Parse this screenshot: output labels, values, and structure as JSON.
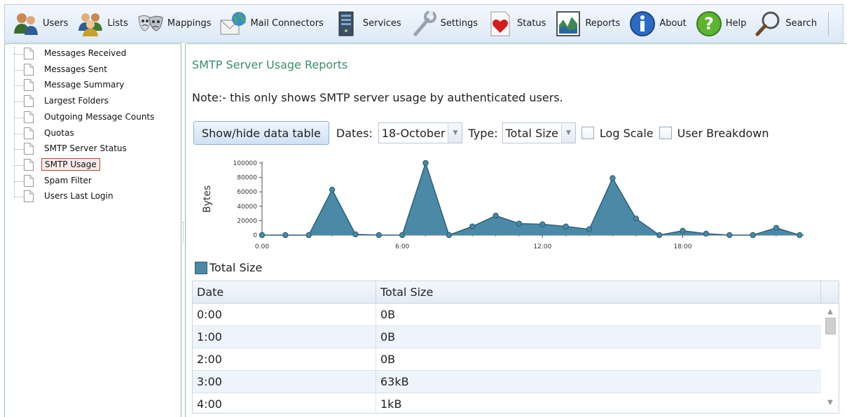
{
  "toolbar": {
    "items": [
      {
        "label": "Users",
        "icon": "users-icon"
      },
      {
        "label": "Lists",
        "icon": "lists-icon"
      },
      {
        "label": "Mappings",
        "icon": "mappings-icon"
      },
      {
        "label": "Mail Connectors",
        "icon": "mail-connectors-icon"
      },
      {
        "label": "Services",
        "icon": "services-icon"
      },
      {
        "label": "Settings",
        "icon": "settings-icon"
      },
      {
        "label": "Status",
        "icon": "status-icon"
      },
      {
        "label": "Reports",
        "icon": "reports-icon"
      },
      {
        "label": "About",
        "icon": "about-icon"
      },
      {
        "label": "Help",
        "icon": "help-icon"
      },
      {
        "label": "Search",
        "icon": "search-icon"
      }
    ]
  },
  "sidebar": {
    "items": [
      {
        "label": "Messages Received"
      },
      {
        "label": "Messages Sent"
      },
      {
        "label": "Message Summary"
      },
      {
        "label": "Largest Folders"
      },
      {
        "label": "Outgoing Message Counts"
      },
      {
        "label": "Quotas"
      },
      {
        "label": "SMTP Server Status"
      },
      {
        "label": "SMTP Usage",
        "selected": true
      },
      {
        "label": "Spam Filter"
      },
      {
        "label": "Users Last Login"
      }
    ]
  },
  "main": {
    "title": "SMTP Server Usage Reports",
    "note": "Note:- this only shows SMTP server usage by authenticated users.",
    "toggle_button": "Show/hide data table",
    "dates_label": "Dates:",
    "dates_value": "18-October",
    "type_label": "Type:",
    "type_value": "Total Size",
    "log_scale_label": "Log Scale",
    "user_breakdown_label": "User Breakdown",
    "legend_label": "Total Size"
  },
  "table": {
    "headers": [
      "Date",
      "Total Size"
    ],
    "rows": [
      [
        "0:00",
        "0B"
      ],
      [
        "1:00",
        "0B"
      ],
      [
        "2:00",
        "0B"
      ],
      [
        "3:00",
        "63kB"
      ],
      [
        "4:00",
        "1kB"
      ]
    ]
  },
  "colors": {
    "series_fill": "#4b8aa6",
    "series_line": "#2d6078",
    "title_green": "#3a8f6a"
  },
  "chart_data": {
    "type": "area",
    "ylabel": "Bytes",
    "xlabel": "",
    "ylim": [
      0,
      100000
    ],
    "yticks": [
      0,
      20000,
      40000,
      60000,
      80000,
      100000
    ],
    "xtick_labels": [
      "0:00",
      "6:00",
      "12:00",
      "18:00"
    ],
    "x": [
      0,
      1,
      2,
      3,
      4,
      5,
      6,
      7,
      8,
      9,
      10,
      11,
      12,
      13,
      14,
      15,
      16,
      17,
      18,
      19,
      20,
      21,
      22,
      23
    ],
    "series": [
      {
        "name": "Total Size",
        "values": [
          0,
          0,
          0,
          63000,
          1000,
          0,
          0,
          100000,
          0,
          12000,
          27000,
          16000,
          15000,
          12000,
          8000,
          79000,
          23000,
          0,
          6000,
          2000,
          0,
          0,
          10000,
          0
        ]
      }
    ],
    "grid": false,
    "legend": "bottom-left"
  }
}
